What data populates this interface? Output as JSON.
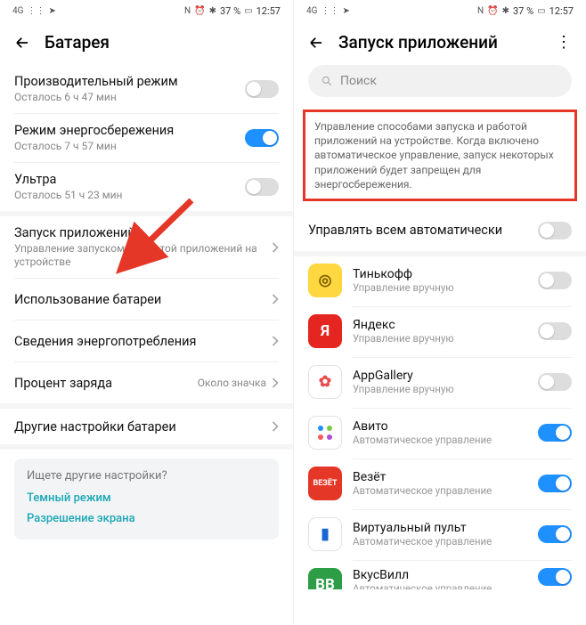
{
  "status": {
    "signal": "4G",
    "nfc": "N",
    "bt": "✱",
    "battery_pct": "37 %",
    "time": "12:57"
  },
  "left": {
    "title": "Батарея",
    "rows": {
      "perf": {
        "title": "Производительный режим",
        "sub": "Осталось 6 ч 47 мин"
      },
      "saver": {
        "title": "Режим энергосбережения",
        "sub": "Осталось 7 ч 57 мин"
      },
      "ultra": {
        "title": "Ультра",
        "sub": "Осталось 51 ч 23 мин"
      },
      "launch": {
        "title": "Запуск приложений",
        "sub": "Управление запуском и работой приложений на устройстве"
      },
      "usage": {
        "title": "Использование батареи"
      },
      "details": {
        "title": "Сведения энергопотребления"
      },
      "percent": {
        "title": "Процент заряда",
        "value": "Около значка"
      },
      "other": {
        "title": "Другие настройки батареи"
      }
    },
    "tip": {
      "q": "Ищете другие настройки?",
      "link1": "Темный режим",
      "link2": "Разрешение экрана"
    }
  },
  "right": {
    "title": "Запуск приложений",
    "search_placeholder": "Поиск",
    "banner": "Управление способами запуска и работой приложений на устройстве. Когда включено автоматическое управление, запуск некоторых приложений будет запрещен для энергосбережения.",
    "auto_all": "Управлять всем автоматически",
    "sub_manual": "Управление вручную",
    "sub_auto": "Автоматическое управление",
    "apps": [
      {
        "name": "Тинькофф",
        "mode": "manual",
        "on": false,
        "bg": "#ffd740",
        "fg": "#7a5d00",
        "letter": "◎"
      },
      {
        "name": "Яндекс",
        "mode": "manual",
        "on": false,
        "bg": "#e52620",
        "fg": "#fff",
        "letter": "Я"
      },
      {
        "name": "AppGallery",
        "mode": "manual",
        "on": false,
        "bg": "#fff",
        "fg": "#e84b4b",
        "letter": "✿",
        "border": true
      },
      {
        "name": "Авито",
        "mode": "auto",
        "on": true,
        "bg": "#fff",
        "fg": "#000",
        "letter": "⁙",
        "dots": true,
        "border": true
      },
      {
        "name": "Везёт",
        "mode": "auto",
        "on": true,
        "bg": "#e53727",
        "fg": "#fff",
        "letter": "ВЕЗЁТ",
        "small": true
      },
      {
        "name": "Виртуальный пульт",
        "mode": "auto",
        "on": true,
        "bg": "#fff",
        "fg": "#1867d2",
        "letter": "▮",
        "border": true
      },
      {
        "name": "ВкусВилл",
        "mode": "auto",
        "on": true,
        "bg": "#2e9e46",
        "fg": "#fff",
        "letter": "ВВ",
        "cut": true
      }
    ]
  }
}
